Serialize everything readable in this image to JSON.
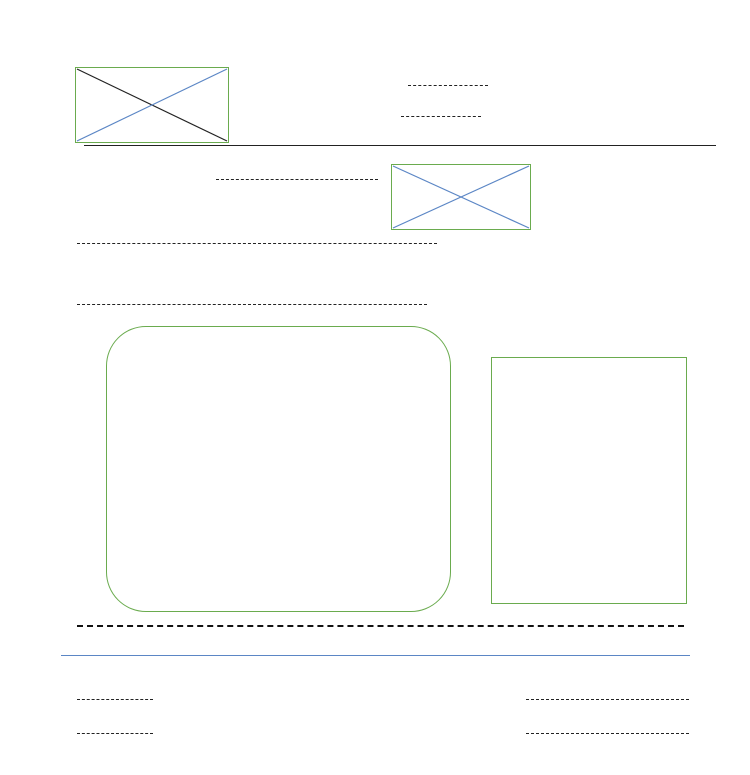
{
  "header": {
    "logo_placeholder": {
      "icon": "image-placeholder-icon",
      "cross_colors": [
        "#222222",
        "#5b86c5"
      ]
    },
    "title_lines": 2
  },
  "colors": {
    "placeholder_border": "#6aab4e",
    "rule_black": "#222222",
    "rule_blue": "#5b86c5",
    "dash": "#222222"
  },
  "subheader": {
    "image_placeholder": {
      "icon": "image-placeholder-icon",
      "cross_colors": [
        "#5b86c5",
        "#5b86c5"
      ]
    }
  },
  "body": {
    "text_lines": 2
  },
  "panels": {
    "left": {
      "shape": "rounded-rectangle"
    },
    "right": {
      "shape": "rectangle"
    }
  },
  "footer": {
    "left_lines": 2,
    "right_lines": 2
  }
}
